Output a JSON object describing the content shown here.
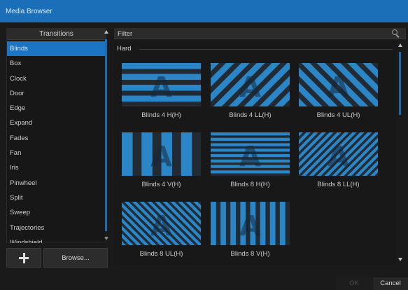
{
  "window": {
    "title": "Media Browser"
  },
  "sidebar": {
    "header": "Transitions",
    "items": [
      {
        "label": "Blinds",
        "selected": true
      },
      {
        "label": "Box"
      },
      {
        "label": "Clock"
      },
      {
        "label": "Door"
      },
      {
        "label": "Edge"
      },
      {
        "label": "Expand"
      },
      {
        "label": "Fades"
      },
      {
        "label": "Fan"
      },
      {
        "label": "Iris"
      },
      {
        "label": "Pinwheel"
      },
      {
        "label": "Split"
      },
      {
        "label": "Sweep"
      },
      {
        "label": "Trajectories"
      },
      {
        "label": "Windshield"
      }
    ],
    "add_icon": "plus-icon",
    "browse_label": "Browse..."
  },
  "filter": {
    "label": "Filter",
    "icon": "search-icon"
  },
  "group": {
    "label": "Hard"
  },
  "tiles": [
    {
      "label": "Blinds 4 H(H)",
      "pattern": "h4"
    },
    {
      "label": "Blinds 4 LL(H)",
      "pattern": "dl4"
    },
    {
      "label": "Blinds 4 UL(H)",
      "pattern": "du4"
    },
    {
      "label": "Blinds 4 V(H)",
      "pattern": "v4"
    },
    {
      "label": "Blinds 8 H(H)",
      "pattern": "h8"
    },
    {
      "label": "Blinds 8 LL(H)",
      "pattern": "dl8"
    },
    {
      "label": "Blinds 8 UL(H)",
      "pattern": "du8"
    },
    {
      "label": "Blinds 8 V(H)",
      "pattern": "v8"
    }
  ],
  "footer": {
    "ok_label": "OK",
    "cancel_label": "Cancel"
  },
  "colors": {
    "accent": "#1b74c4",
    "stripe_blue": "#2a86c7",
    "stripe_dark": "#222a33"
  }
}
